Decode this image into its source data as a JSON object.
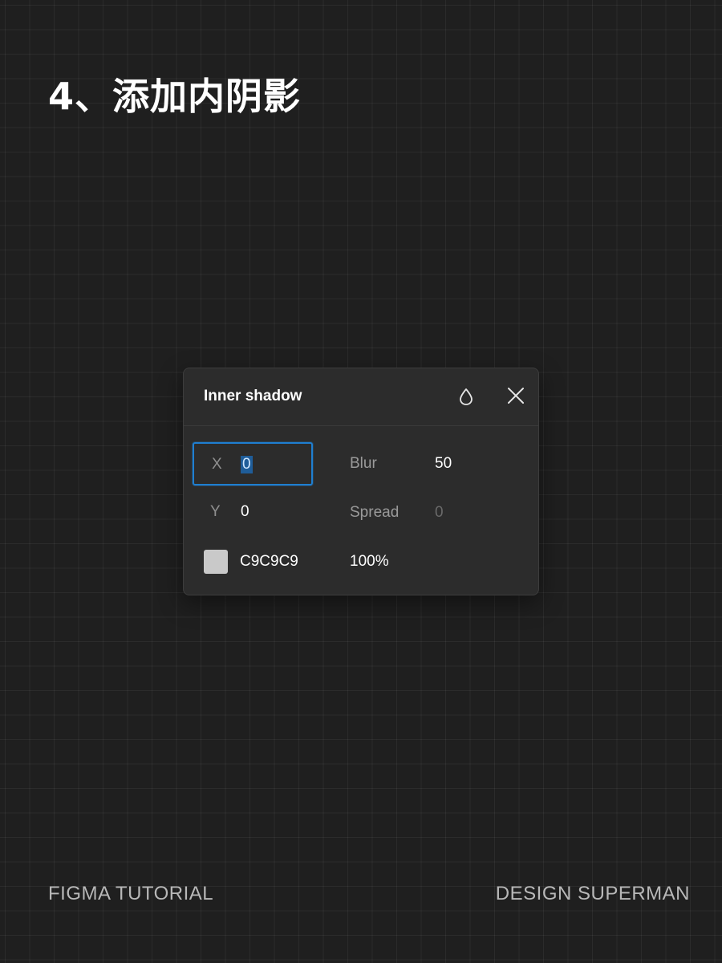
{
  "page": {
    "title": "4、添加内阴影"
  },
  "panel": {
    "title": "Inner shadow",
    "icons": {
      "style": "drop-icon",
      "close": "close-icon"
    },
    "fields": {
      "x": {
        "label": "X",
        "value": "0"
      },
      "y": {
        "label": "Y",
        "value": "0"
      },
      "blur": {
        "label": "Blur",
        "value": "50"
      },
      "spread": {
        "label": "Spread",
        "value": "0"
      }
    },
    "color": {
      "hex": "C9C9C9",
      "swatch": "#c9c9c9",
      "opacity": "100%"
    },
    "accent": "#1f7fd1"
  },
  "footer": {
    "left": "FIGMA TUTORIAL",
    "right": "DESIGN SUPERMAN"
  }
}
